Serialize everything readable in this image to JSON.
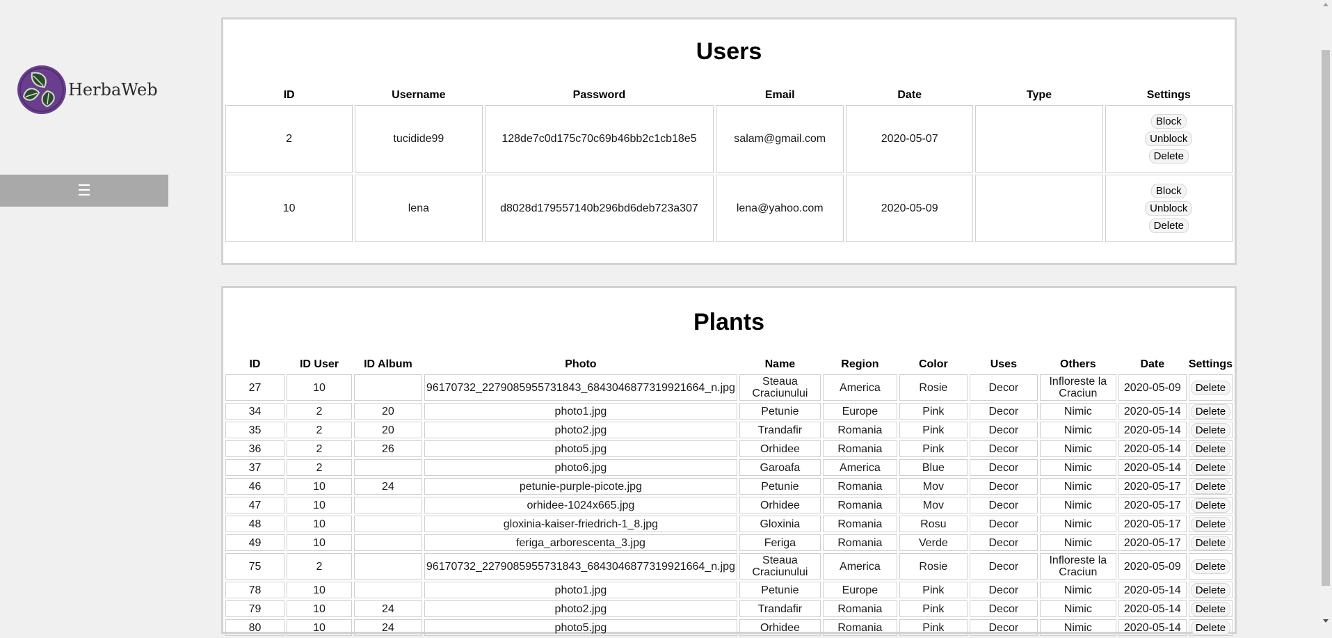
{
  "logo": {
    "text": "HerbaWeb",
    "icon": "leaf-logo-icon",
    "brand_color": "#6a3d8f"
  },
  "menu": {
    "icon": "☰"
  },
  "users": {
    "title": "Users",
    "columns": [
      "ID",
      "Username",
      "Password",
      "Email",
      "Date",
      "Type",
      "Settings"
    ],
    "rows": [
      {
        "id": "2",
        "username": "tucidide99",
        "password": "128de7c0d175c70c69b46bb2c1cb18e5",
        "email": "salam@gmail.com",
        "date": "2020-05-07",
        "type": ""
      },
      {
        "id": "10",
        "username": "lena",
        "password": "d8028d179557140b296bd6deb723a307",
        "email": "lena@yahoo.com",
        "date": "2020-05-09",
        "type": ""
      }
    ],
    "buttons": {
      "block": "Block",
      "unblock": "Unblock",
      "delete": "Delete"
    }
  },
  "plants": {
    "title": "Plants",
    "columns": [
      "ID",
      "ID User",
      "ID Album",
      "Photo",
      "Name",
      "Region",
      "Color",
      "Uses",
      "Others",
      "Date",
      "Settings"
    ],
    "delete_label": "Delete",
    "rows": [
      [
        "27",
        "10",
        "",
        "96170732_2279085955731843_6843046877319921664_n.jpg",
        "Steaua Craciunului",
        "America",
        "Rosie",
        "Decor",
        "Infloreste la Craciun",
        "2020-05-09"
      ],
      [
        "34",
        "2",
        "20",
        "photo1.jpg",
        "Petunie",
        "Europe",
        "Pink",
        "Decor",
        "Nimic",
        "2020-05-14"
      ],
      [
        "35",
        "2",
        "20",
        "photo2.jpg",
        "Trandafir",
        "Romania",
        "Pink",
        "Decor",
        "Nimic",
        "2020-05-14"
      ],
      [
        "36",
        "2",
        "26",
        "photo5.jpg",
        "Orhidee",
        "Romania",
        "Pink",
        "Decor",
        "Nimic",
        "2020-05-14"
      ],
      [
        "37",
        "2",
        "",
        "photo6.jpg",
        "Garoafa",
        "America",
        "Blue",
        "Decor",
        "Nimic",
        "2020-05-14"
      ],
      [
        "46",
        "10",
        "24",
        "petunie-purple-picote.jpg",
        "Petunie",
        "Romania",
        "Mov",
        "Decor",
        "Nimic",
        "2020-05-17"
      ],
      [
        "47",
        "10",
        "",
        "orhidee-1024x665.jpg",
        "Orhidee",
        "Romania",
        "Mov",
        "Decor",
        "Nimic",
        "2020-05-17"
      ],
      [
        "48",
        "10",
        "",
        "gloxinia-kaiser-friedrich-1_8.jpg",
        "Gloxinia",
        "Romania",
        "Rosu",
        "Decor",
        "Nimic",
        "2020-05-17"
      ],
      [
        "49",
        "10",
        "",
        "feriga_arborescenta_3.jpg",
        "Feriga",
        "Romania",
        "Verde",
        "Decor",
        "Nimic",
        "2020-05-17"
      ],
      [
        "75",
        "2",
        "",
        "96170732_2279085955731843_6843046877319921664_n.jpg",
        "Steaua Craciunului",
        "America",
        "Rosie",
        "Decor",
        "Infloreste la Craciun",
        "2020-05-09"
      ],
      [
        "78",
        "10",
        "",
        "photo1.jpg",
        "Petunie",
        "Europe",
        "Pink",
        "Decor",
        "Nimic",
        "2020-05-14"
      ],
      [
        "79",
        "10",
        "24",
        "photo2.jpg",
        "Trandafir",
        "Romania",
        "Pink",
        "Decor",
        "Nimic",
        "2020-05-14"
      ],
      [
        "80",
        "10",
        "24",
        "photo5.jpg",
        "Orhidee",
        "Romania",
        "Pink",
        "Decor",
        "Nimic",
        "2020-05-14"
      ]
    ]
  }
}
